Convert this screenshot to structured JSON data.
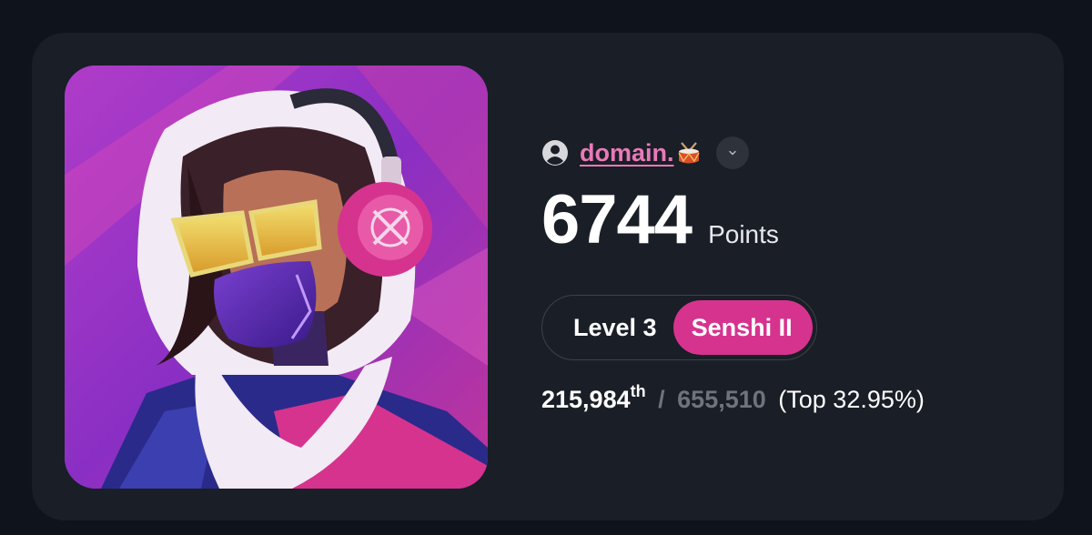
{
  "profile": {
    "username": "domain.",
    "username_emoji_icon": "drum-icon",
    "points": "6744",
    "points_label": "Points",
    "level_label": "Level 3",
    "rank_name": "Senshi II",
    "leaderboard": {
      "position": "215,984",
      "position_suffix": "th",
      "separator": "/",
      "total": "655,510",
      "top_percent": "(Top 32.95%)"
    }
  },
  "colors": {
    "page_background": "#0f131b",
    "card_background": "#1a1e26",
    "username": "#e87ab8",
    "rank_badge": "#d6338f",
    "muted_text": "#6f737c"
  },
  "icons": {
    "user": "user-circle-icon",
    "dropdown": "chevron-down-icon"
  }
}
